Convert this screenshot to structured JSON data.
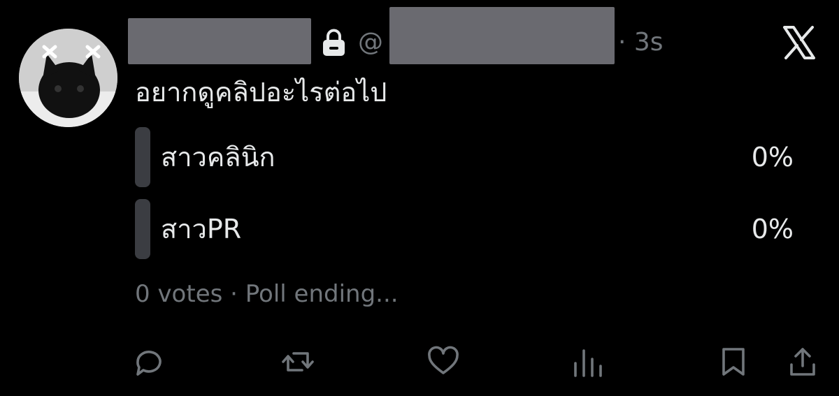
{
  "tweet": {
    "handle_prefix": "@",
    "time": "· 3s",
    "text": "อยากดูคลิปอะไรต่อไป"
  },
  "poll": {
    "options": [
      {
        "label": "สาวคลินิก",
        "percent": "0%"
      },
      {
        "label": "สาวPR",
        "percent": "0%"
      }
    ],
    "meta": "0 votes · Poll ending..."
  },
  "icons": {
    "lock": "lock-icon",
    "brand": "x-logo-icon",
    "actions": [
      "reply-icon",
      "retweet-icon",
      "like-icon",
      "views-icon",
      "bookmark-icon",
      "share-icon"
    ]
  },
  "colors": {
    "background": "#000000",
    "text": "#e7e9ea",
    "muted": "#71767b",
    "poll_bar": "#3b3d42",
    "redaction": "#6a6a70"
  }
}
